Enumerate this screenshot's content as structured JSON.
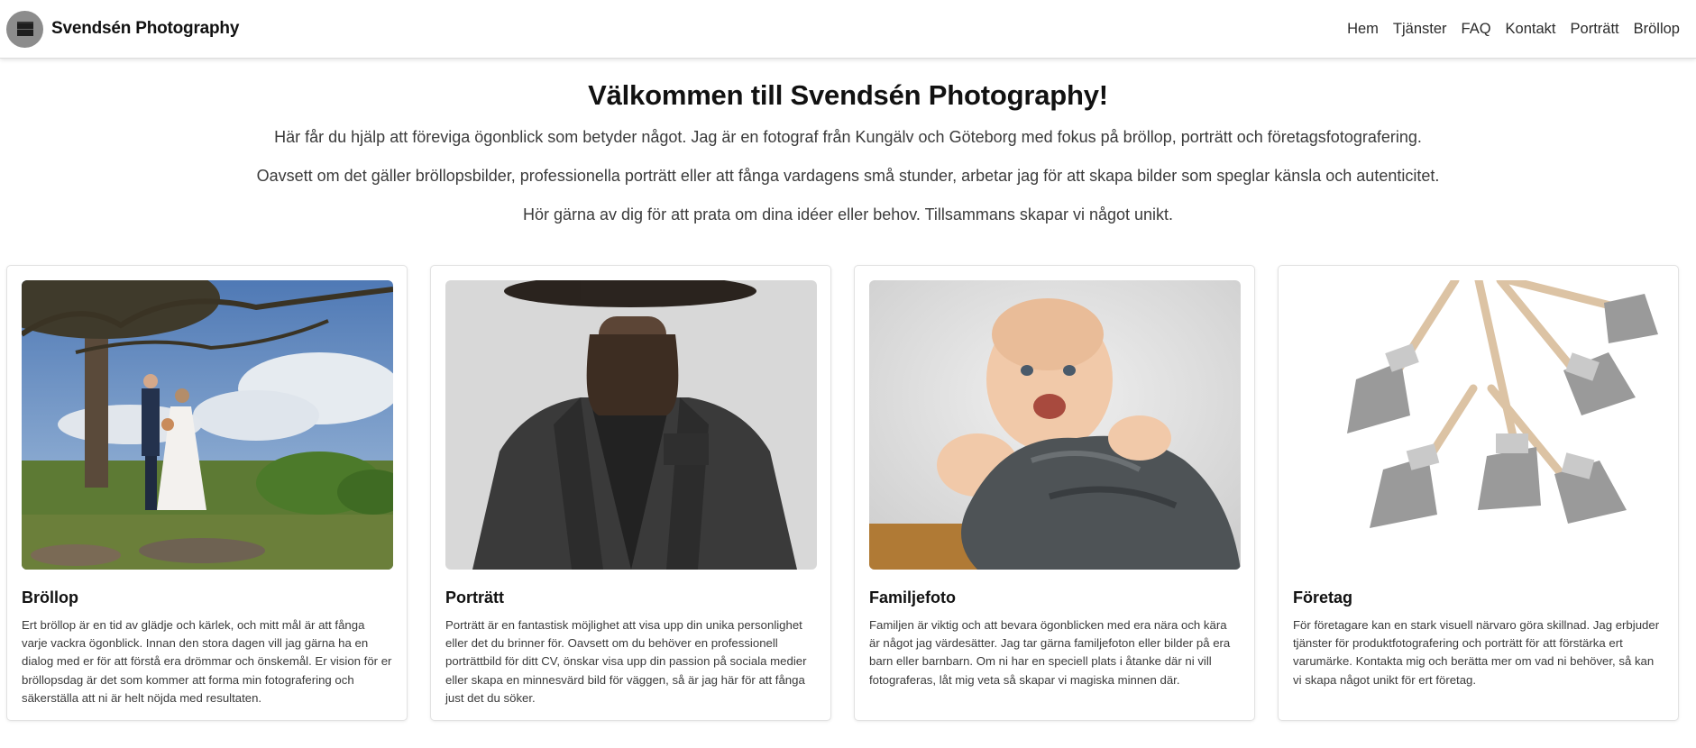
{
  "nav": {
    "brand": "Svendsén Photography",
    "links": [
      "Hem",
      "Tjänster",
      "FAQ",
      "Kontakt",
      "Porträtt",
      "Bröllop"
    ]
  },
  "hero": {
    "title": "Välkommen till Svendsén Photography!",
    "paragraphs": [
      "Här får du hjälp att föreviga ögonblick som betyder något. Jag är en fotograf från Kungälv och Göteborg med fokus på bröllop, porträtt och företagsfotografering.",
      "Oavsett om det gäller bröllopsbilder, professionella porträtt eller att fånga vardagens små stunder, arbetar jag för att skapa bilder som speglar känsla och autenticitet.",
      "Hör gärna av dig för att prata om dina idéer eller behov. Tillsammans skapar vi något unikt."
    ]
  },
  "cards": [
    {
      "title": "Bröllop",
      "text": "Ert bröllop är en tid av glädje och kärlek, och mitt mål är att fånga varje vackra ögonblick. Innan den stora dagen vill jag gärna ha en dialog med er för att förstå era drömmar och önskemål. Er vision för er bröllopsdag är det som kommer att forma min fotografering och säkerställa att ni är helt nöjda med resultaten."
    },
    {
      "title": "Porträtt",
      "text": "Porträtt är en fantastisk möjlighet att visa upp din unika personlighet eller det du brinner för. Oavsett om du behöver en professionell porträttbild för ditt CV, önskar visa upp din passion på sociala medier eller skapa en minnesvärd bild för väggen, så är jag här för att fånga just det du söker."
    },
    {
      "title": "Familjefoto",
      "text": "Familjen är viktig och att bevara ögonblicken med era nära och kära är något jag värdesätter. Jag tar gärna familjefoton eller bilder på era barn eller barnbarn. Om ni har en speciell plats i åtanke där ni vill fotograferas, låt mig veta så skapar vi magiska minnen där."
    },
    {
      "title": "Företag",
      "text": "För företagare kan en stark visuell närvaro göra skillnad. Jag erbjuder tjänster för produktfotografering och porträtt för att förstärka ert varumärke. Kontakta mig och berätta mer om vad ni behöver, så kan vi skapa något unikt för ert företag."
    }
  ]
}
